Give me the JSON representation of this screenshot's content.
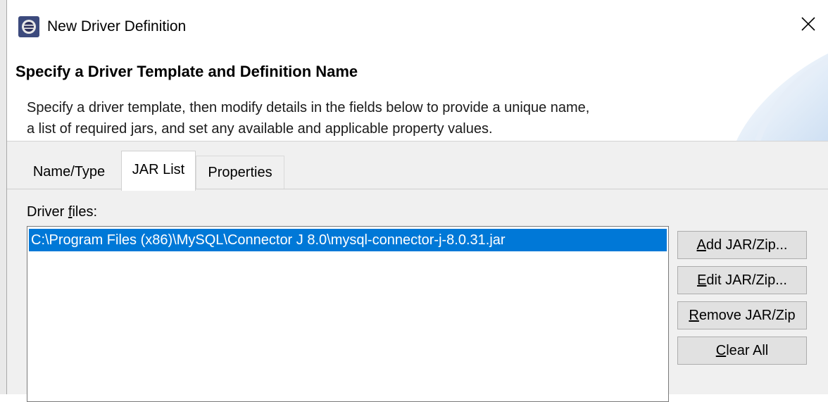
{
  "window": {
    "title": "New Driver Definition",
    "close_glyph": "✕"
  },
  "banner": {
    "title": "Specify a Driver Template and Definition Name",
    "description_line1": "Specify a driver template, then modify details in the fields below to provide a unique name,",
    "description_line2": "a list of required jars, and set any available and applicable property values."
  },
  "tabs": [
    {
      "label": "Name/Type",
      "active": false
    },
    {
      "label": "JAR List",
      "active": true
    },
    {
      "label": "Properties",
      "active": false
    }
  ],
  "jar_list": {
    "label_prefix": "Driver ",
    "label_mnemonic": "f",
    "label_suffix": "iles:",
    "files": [
      {
        "path": "C:\\Program Files (x86)\\MySQL\\Connector J 8.0\\mysql-connector-j-8.0.31.jar",
        "selected": true
      }
    ]
  },
  "buttons": {
    "add": {
      "mnemonic": "A",
      "rest": "dd JAR/Zip..."
    },
    "edit": {
      "mnemonic": "E",
      "rest": "dit JAR/Zip..."
    },
    "remove": {
      "mnemonic": "R",
      "rest": "emove JAR/Zip"
    },
    "clear": {
      "mnemonic": "C",
      "rest": "lear All"
    }
  },
  "colors": {
    "selection": "#0078d7",
    "button_face": "#e1e1e1",
    "panel_bg": "#f0f0f0"
  },
  "icons": {
    "app": "eclipse-icon",
    "close": "close-icon",
    "banner": "wizard-banner-graphic"
  }
}
